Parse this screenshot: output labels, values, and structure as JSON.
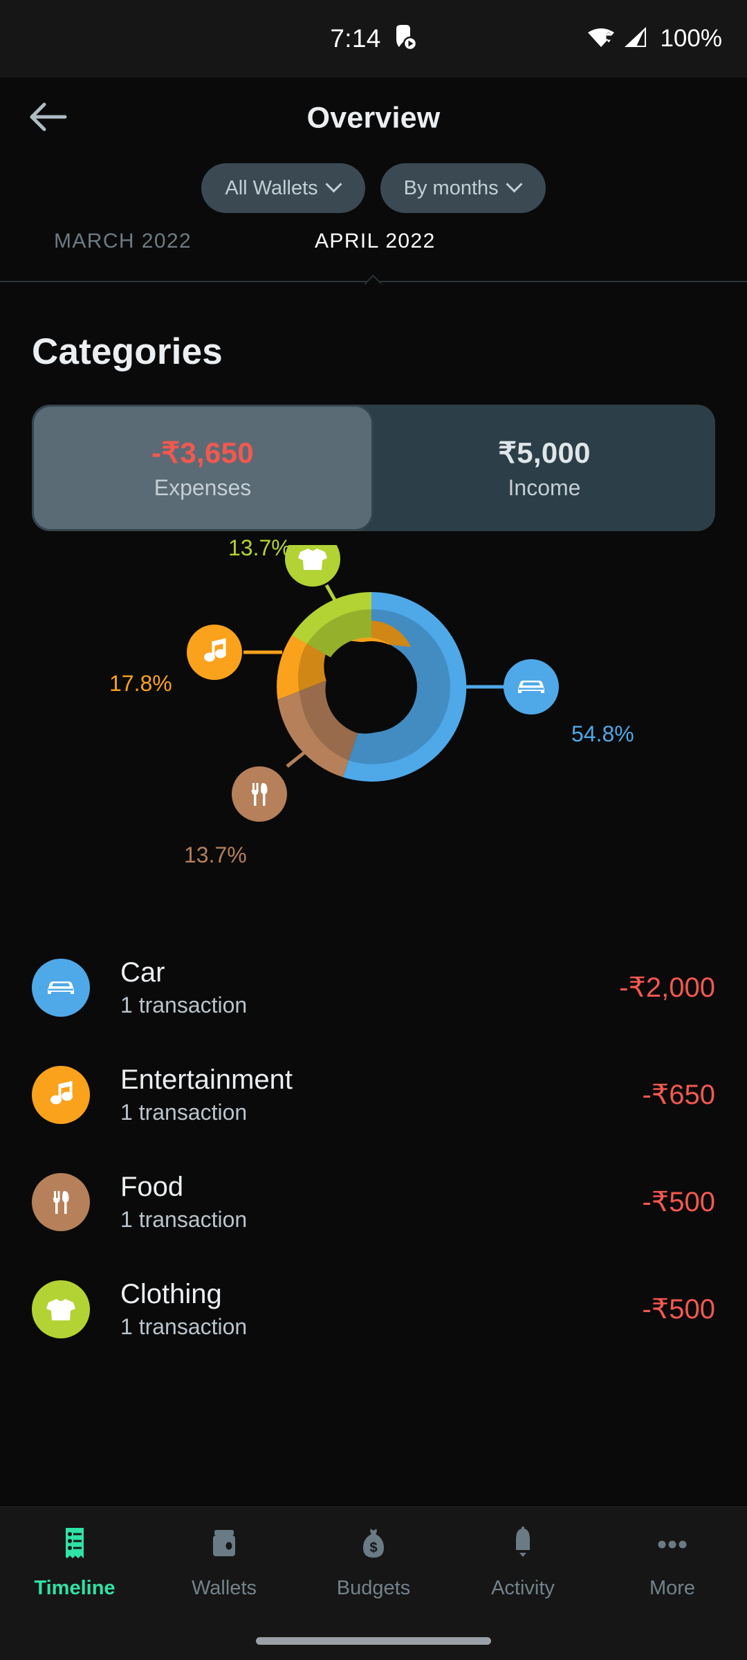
{
  "status_bar": {
    "time": "7:14",
    "notification_icon": "media-notification-icon",
    "wifi_icon": "wifi-icon",
    "signal_icon": "cellular-signal-icon",
    "battery": "100%"
  },
  "app_bar": {
    "back_icon": "back-arrow-icon",
    "title": "Overview"
  },
  "filters": [
    {
      "label": "All Wallets",
      "icon": "chevron-down-icon"
    },
    {
      "label": "By months",
      "icon": "chevron-down-icon"
    }
  ],
  "month_tabs": {
    "previous": "MARCH 2022",
    "current": "APRIL 2022"
  },
  "section": {
    "title": "Categories"
  },
  "summary_toggle": {
    "expenses": {
      "amount": "-₹3,650",
      "label": "Expenses",
      "selected": true
    },
    "income": {
      "amount": "₹5,000",
      "label": "Income",
      "selected": false
    }
  },
  "colors": {
    "car": "#4FA8E8",
    "entertainment": "#FAA21B",
    "food": "#B5805A",
    "clothing": "#B3D334",
    "negative": "#F4584F",
    "accent": "#2FE3A6",
    "background": "#0A0A0A",
    "segment_active": "#5A6B75",
    "segment_inactive": "#2C3E47"
  },
  "chart_data": {
    "type": "pie",
    "title": "Categories",
    "categories": [
      "Car",
      "Entertainment",
      "Food",
      "Clothing"
    ],
    "values": [
      2000,
      650,
      500,
      500
    ],
    "percentages": [
      54.8,
      17.8,
      13.7,
      13.7
    ],
    "percent_labels": [
      "54.8%",
      "17.8%",
      "13.7%",
      "13.7%"
    ],
    "colors": [
      "#4FA8E8",
      "#FAA21B",
      "#B5805A",
      "#B3D334"
    ],
    "icons": [
      "car-icon",
      "music-note-icon",
      "cutlery-icon",
      "tshirt-icon"
    ],
    "total": 3650,
    "currency": "₹",
    "legend": "callout-bubbles",
    "donut_hole_ratio": 0.48,
    "start_angle_deg": -90,
    "grid": false
  },
  "category_list": [
    {
      "name": "Car",
      "transactions": "1 transaction",
      "amount": "-₹2,000",
      "color": "#4FA8E8",
      "icon": "car-icon"
    },
    {
      "name": "Entertainment",
      "transactions": "1 transaction",
      "amount": "-₹650",
      "color": "#FAA21B",
      "icon": "music-note-icon"
    },
    {
      "name": "Food",
      "transactions": "1 transaction",
      "amount": "-₹500",
      "color": "#B5805A",
      "icon": "cutlery-icon"
    },
    {
      "name": "Clothing",
      "transactions": "1 transaction",
      "amount": "-₹500",
      "color": "#B3D334",
      "icon": "tshirt-icon"
    }
  ],
  "bottom_nav": [
    {
      "label": "Timeline",
      "icon": "receipt-icon",
      "active": true
    },
    {
      "label": "Wallets",
      "icon": "wallet-icon",
      "active": false
    },
    {
      "label": "Budgets",
      "icon": "money-bag-icon",
      "active": false
    },
    {
      "label": "Activity",
      "icon": "bell-icon",
      "active": false
    },
    {
      "label": "More",
      "icon": "ellipsis-icon",
      "active": false
    }
  ]
}
